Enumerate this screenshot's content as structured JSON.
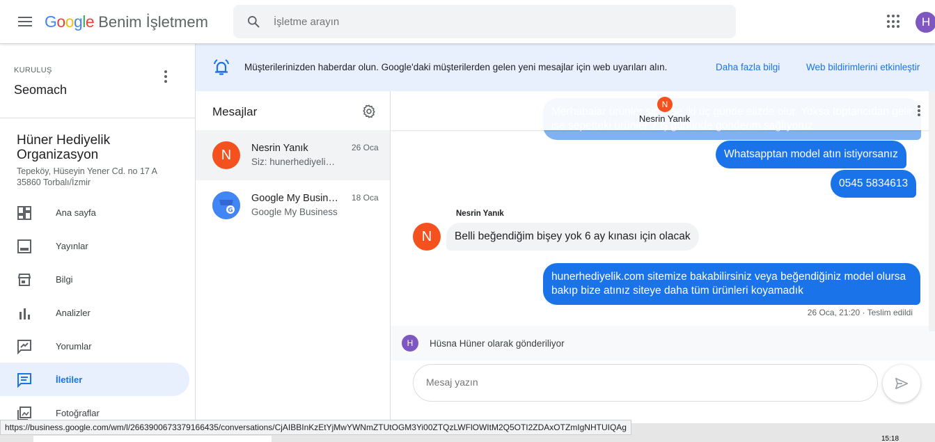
{
  "topbar": {
    "logo_letters": [
      {
        "ch": "G",
        "color": "#4285F4"
      },
      {
        "ch": "o",
        "color": "#EA4335"
      },
      {
        "ch": "o",
        "color": "#FBBC05"
      },
      {
        "ch": "g",
        "color": "#4285F4"
      },
      {
        "ch": "l",
        "color": "#34A853"
      },
      {
        "ch": "e",
        "color": "#EA4335"
      }
    ],
    "product": "Benim İşletmem",
    "search_placeholder": "İşletme arayın",
    "user_initial": "H"
  },
  "org": {
    "label": "KURULUŞ",
    "name": "Seomach"
  },
  "business": {
    "name": "Hüner Hediyelik Organizasyon",
    "address_line1": "Tepeköy, Hüseyin Yener Cd. no 17 A",
    "address_line2": "35860 Torbalı/İzmir"
  },
  "nav": [
    {
      "label": "Ana sayfa",
      "icon": "dashboard-icon",
      "active": false
    },
    {
      "label": "Yayınlar",
      "icon": "posts-icon",
      "active": false
    },
    {
      "label": "Bilgi",
      "icon": "storefront-icon",
      "active": false
    },
    {
      "label": "Analizler",
      "icon": "bar-chart-icon",
      "active": false
    },
    {
      "label": "Yorumlar",
      "icon": "reviews-icon",
      "active": false
    },
    {
      "label": "İletiler",
      "icon": "message-icon",
      "active": true
    },
    {
      "label": "Fotoğraflar",
      "icon": "photos-icon",
      "active": false
    }
  ],
  "banner": {
    "text": "Müşterilerinizden haberdar olun. Google'daki müşterilerden gelen yeni mesajlar için web uyarıları alın.",
    "link_more": "Daha fazla bilgi",
    "link_enable": "Web bildirimlerini etkinleştir"
  },
  "conversations": {
    "title": "Mesajlar",
    "items": [
      {
        "name": "Nesrin Yanık",
        "snippet": "Siz: hunerhediyelik.com sitemize",
        "date": "26 Oca",
        "initial": "N",
        "color": "#f4511e"
      },
      {
        "name": "Google My Business",
        "snippet": "Google My Business",
        "date": "18 Oca",
        "initial": "",
        "color": "#4285F4"
      }
    ]
  },
  "chat": {
    "header_name": "Nesrin Yanık",
    "header_initial": "N",
    "messages": {
      "partial_top": "Merhabalar ürünler siparişe iki üç günde elizde olur. Yoksa toptancıdan gelir ise sepetteki ürünler 7 iş gününde gönderim sağlıyoruz",
      "whatsapp": "Whatsapptan model atın istiyorsanız",
      "phone": "0545 5834613",
      "incoming_sender": "Nesrin Yanık",
      "incoming_initial": "N",
      "incoming": "Belli beğendiğim bişey yok 6 ay kınası için olacak",
      "site": "hunerhediyelik.com sitemize bakabilirsiniz veya beğendiğiniz model olursa bakıp bize atınız siteye daha tüm ürünleri koyamadık",
      "meta": "26 Oca, 21:20 · Teslim edildi"
    },
    "sending_as_initial": "H",
    "sending_as": "Hüsna Hüner olarak gönderiliyor",
    "compose_placeholder": "Mesaj yazın"
  },
  "statusbar": {
    "url": "https://business.google.com/wm/l/2663900673379166435/conversations/CjAIBBInKzEtYjMwYWNmZTUtOGM3Yi00ZTQzLWFlOWItM2Q5OTI2ZDAxOTZmIgNHTUIQAg"
  },
  "taskbar": {
    "clock": "15:18"
  }
}
